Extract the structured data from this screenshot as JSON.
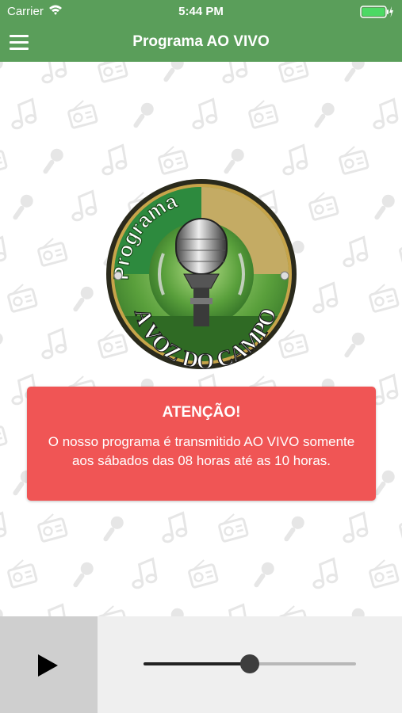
{
  "status_bar": {
    "carrier": "Carrier",
    "time": "5:44 PM"
  },
  "nav": {
    "title": "Programa AO VIVO",
    "menu_icon": "hamburger-menu-icon"
  },
  "logo": {
    "top_text": "Programa",
    "bottom_text": "A VOZ DO CAMPO"
  },
  "alert": {
    "title": "ATENÇÃO!",
    "message": "O nosso programa é transmitido AO VIVO somente aos sábados das 08 horas até as 10 horas."
  },
  "player": {
    "play_icon": "play-icon",
    "volume_level": 0.5
  },
  "colors": {
    "header": "#5a9e5a",
    "alert": "#f05555",
    "player_bg": "#efefef",
    "play_bg": "#cfcfcf"
  }
}
